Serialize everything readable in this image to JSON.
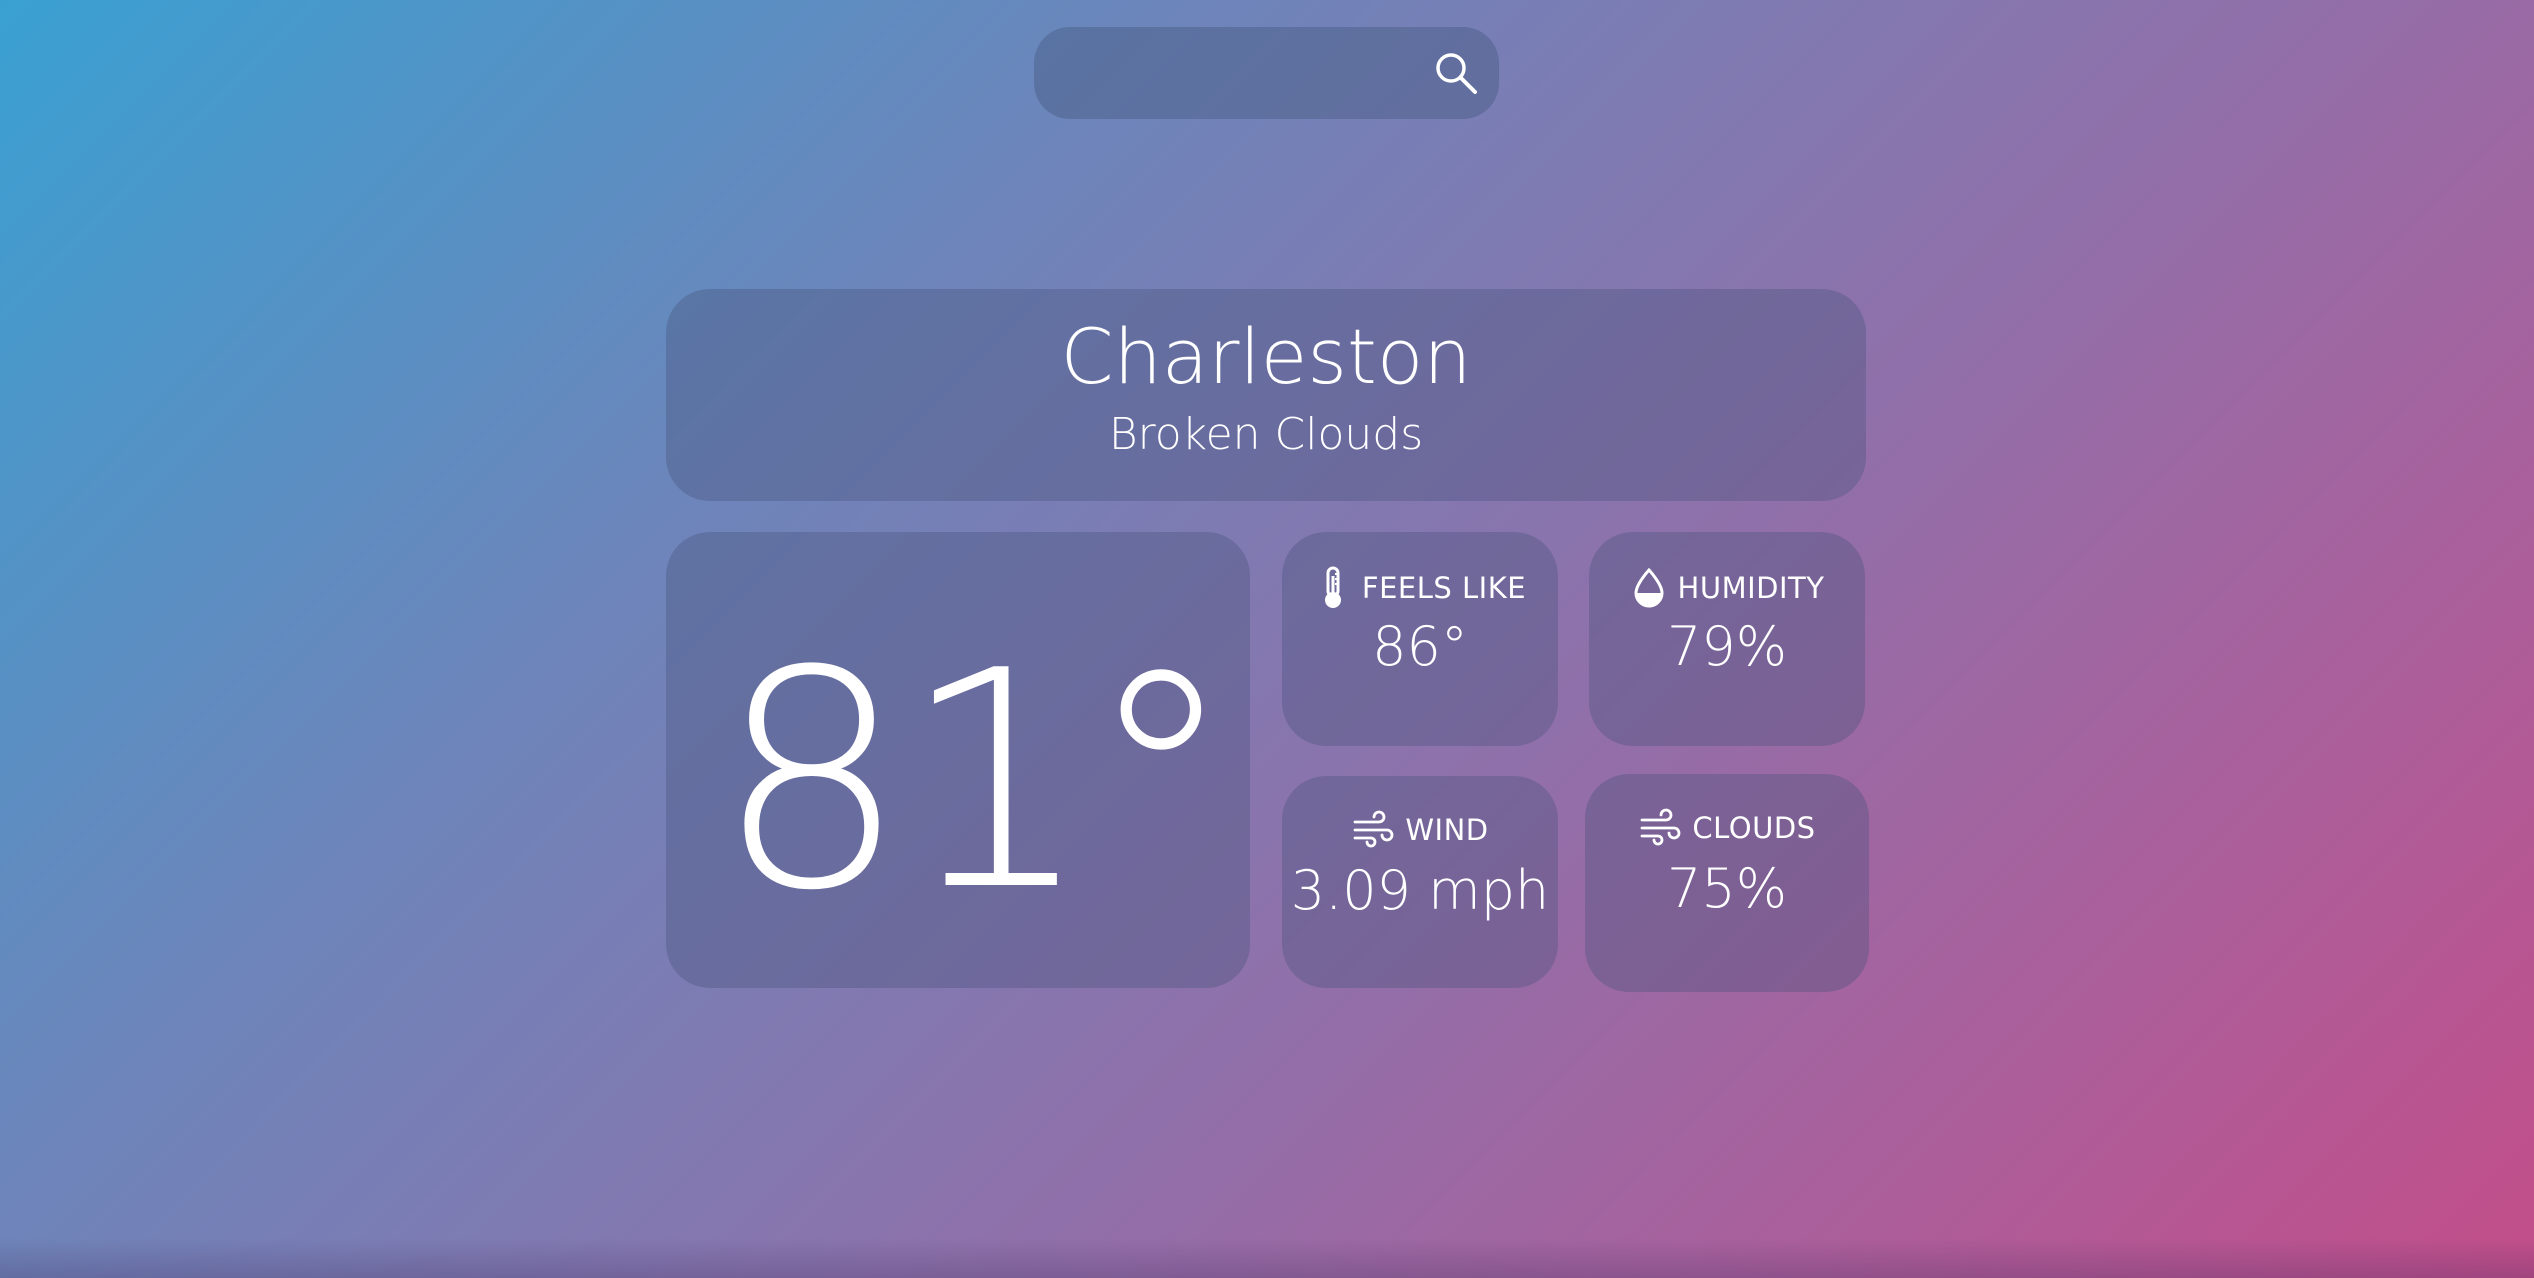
{
  "search": {
    "placeholder": "",
    "value": ""
  },
  "location": {
    "city": "Charleston",
    "condition": "Broken Clouds"
  },
  "current": {
    "temperature": "81°"
  },
  "stats": {
    "feels_like": {
      "label": "FEELS LIKE",
      "value": "86°",
      "icon": "thermometer-icon"
    },
    "humidity": {
      "label": "HUMIDITY",
      "value": "79%",
      "icon": "droplet-icon"
    },
    "wind": {
      "label": "WIND",
      "value": "3.09 mph",
      "icon": "wind-icon"
    },
    "clouds": {
      "label": "CLOUDS",
      "value": "75%",
      "icon": "wind-icon"
    }
  },
  "colors": {
    "gradient_start": "#3aa0d2",
    "gradient_end": "#c24e8a",
    "panel": "#5a6a96",
    "text": "#ffffff"
  }
}
